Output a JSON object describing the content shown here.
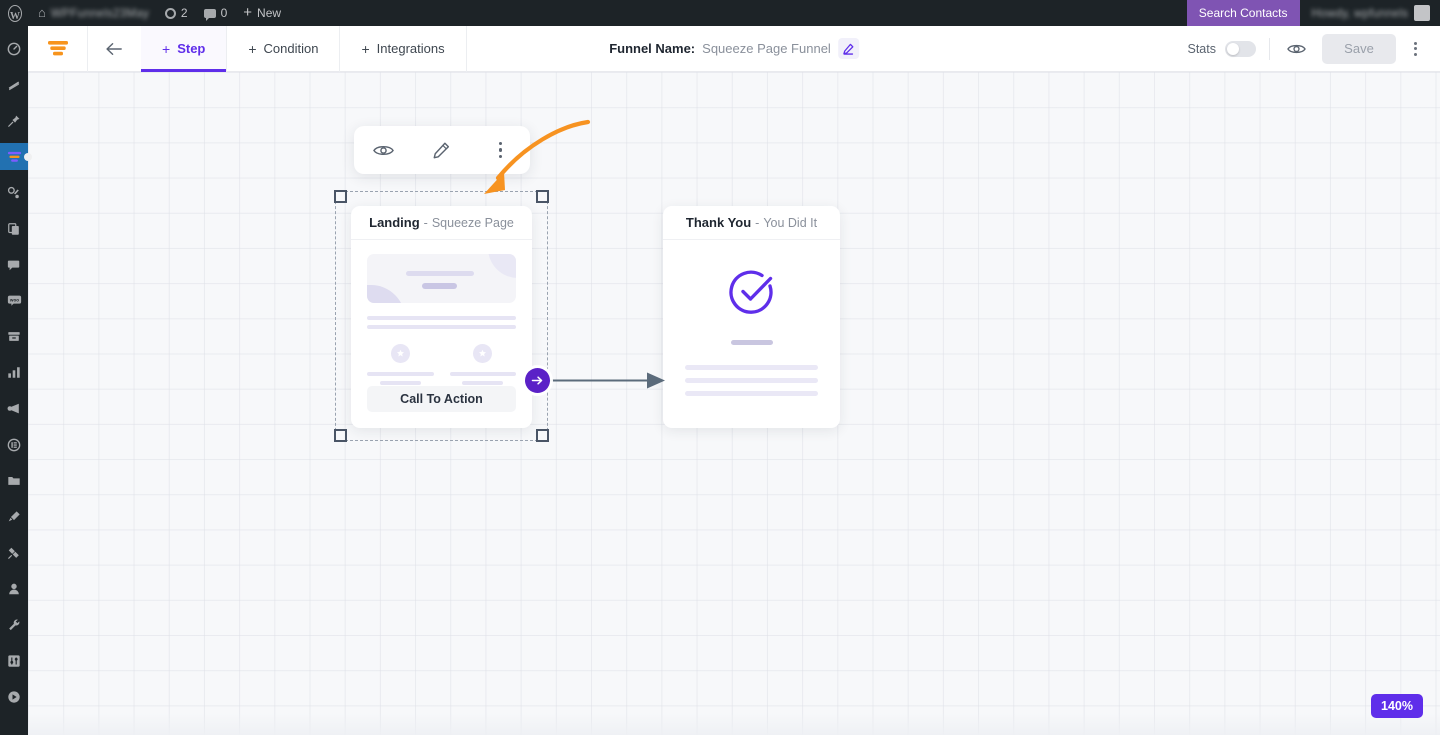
{
  "adminbar": {
    "wp_logo_icon": "wordpress-logo-icon",
    "home_icon": "home-icon",
    "site_name": "WPFunnels23May",
    "updates_icon": "updates-icon",
    "updates_count": "2",
    "comments_icon": "comments-icon",
    "comments_count": "0",
    "new_icon": "plus-icon",
    "new_label": "New",
    "search_contacts_label": "Search Contacts",
    "search_contacts_bg": "#7f54b3",
    "howdy_label": "Howdy, wpfunnels",
    "avatar_icon": "avatar-icon"
  },
  "sidebar": {
    "items": [
      {
        "name": "dashboard",
        "icon": "dashboard-icon",
        "active": false
      },
      {
        "name": "posts",
        "icon": "posts-icon",
        "active": false
      },
      {
        "name": "media",
        "icon": "pin-icon",
        "active": false
      },
      {
        "name": "wpfunnels",
        "icon": "funnel-icon",
        "active": true
      },
      {
        "name": "mail-mint",
        "icon": "mail-note-icon",
        "active": false
      },
      {
        "name": "pages",
        "icon": "pages-icon",
        "active": false
      },
      {
        "name": "comments",
        "icon": "comment-bubble-icon",
        "active": false
      },
      {
        "name": "woocommerce",
        "icon": "woo-icon",
        "active": false
      },
      {
        "name": "products",
        "icon": "archive-icon",
        "active": false
      },
      {
        "name": "analytics",
        "icon": "bar-chart-icon",
        "active": false
      },
      {
        "name": "marketing",
        "icon": "megaphone-icon",
        "active": false
      },
      {
        "name": "elementor",
        "icon": "elementor-icon",
        "active": false
      },
      {
        "name": "templates",
        "icon": "folder-icon",
        "active": false
      },
      {
        "name": "appearance",
        "icon": "paintbrush-icon",
        "active": false
      },
      {
        "name": "plugins",
        "icon": "plug-icon",
        "active": false
      },
      {
        "name": "users",
        "icon": "user-icon",
        "active": false
      },
      {
        "name": "tools",
        "icon": "wrench-icon",
        "active": false
      },
      {
        "name": "settings",
        "icon": "sliders-icon",
        "active": false
      },
      {
        "name": "collapse",
        "icon": "play-circle-icon",
        "active": false
      }
    ]
  },
  "header": {
    "logo_icon": "wpfunnels-logo-icon",
    "back_icon": "arrow-left-icon",
    "tabs": [
      {
        "label": "Step",
        "icon": "plus-icon",
        "active": true
      },
      {
        "label": "Condition",
        "icon": "plus-icon",
        "active": false
      },
      {
        "label": "Integrations",
        "icon": "plus-icon",
        "active": false
      }
    ],
    "funnel_name_label": "Funnel Name:",
    "funnel_name_value": "Squeeze Page Funnel",
    "edit_icon": "pencil-icon",
    "stats_label": "Stats",
    "stats_enabled": false,
    "preview_icon": "eye-icon",
    "save_label": "Save",
    "save_disabled": true,
    "more_icon": "kebab-menu-icon",
    "accent_color": "#5f2eea"
  },
  "canvas": {
    "step_toolbar": {
      "preview_icon": "eye-icon",
      "edit_icon": "pencil-icon",
      "more_icon": "kebab-menu-icon"
    },
    "annotation": {
      "type": "curved-arrow",
      "color": "#f79321",
      "points_to": "edit-pencil-icon"
    },
    "steps": [
      {
        "id": "landing",
        "title": "Landing",
        "separator": "-",
        "subtitle": "Squeeze Page",
        "selected": true,
        "cta_label": "Call To Action"
      },
      {
        "id": "thankyou",
        "title": "Thank You",
        "separator": "-",
        "subtitle": "You Did It",
        "selected": false,
        "success_icon": "check-circle-icon"
      }
    ],
    "connector": {
      "node_icon": "arrow-right-circle-icon",
      "node_color": "#5b21c7",
      "line_color": "#5b6b7b"
    },
    "zoom_level": "140%",
    "zoom_badge_color": "#5f2eea"
  }
}
